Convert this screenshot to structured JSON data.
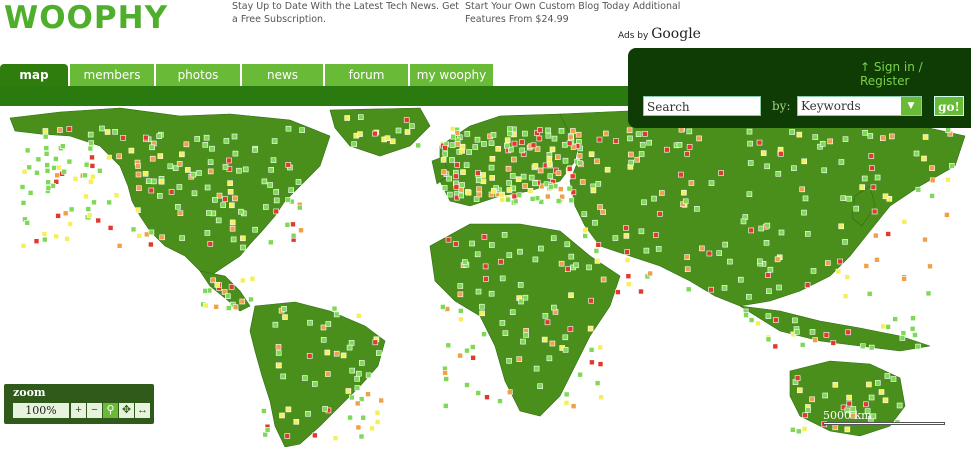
{
  "brand": {
    "logo": "WOOPHY"
  },
  "ads": {
    "ad1": "Stay Up to Date With the Latest Tech News. Get a Free Subscription.",
    "ad2": "Start Your Own Custom Blog Today Additional Features From $24.99",
    "ads_by": "Ads by",
    "google": "Google"
  },
  "nav": {
    "tabs": [
      {
        "label": "map",
        "active": true
      },
      {
        "label": "members"
      },
      {
        "label": "photos"
      },
      {
        "label": "news"
      },
      {
        "label": "forum"
      },
      {
        "label": "my woophy"
      }
    ]
  },
  "account": {
    "signin": "↑ Sign in / Register"
  },
  "search": {
    "value": "Search",
    "by_label": "by:",
    "selected": "Keywords",
    "go_label": "go!"
  },
  "zoom": {
    "title": "zoom",
    "level": "100%",
    "plus": "+",
    "minus": "−",
    "buttons": [
      "magnify-icon",
      "pan-icon",
      "fit-icon"
    ]
  },
  "scale": {
    "label": "5000 km"
  },
  "colors": {
    "land": "#4a8f1c",
    "accent": "#69ba36",
    "dark": "#0f3b05",
    "marker_green": "#7ed957",
    "marker_yellow": "#f4ef5a",
    "marker_orange": "#f0a04a",
    "marker_red": "#e03a2e"
  }
}
